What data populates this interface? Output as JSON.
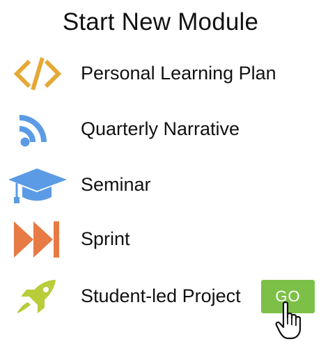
{
  "title": "Start New Module",
  "modules": [
    {
      "label": "Personal Learning Plan",
      "icon": "code-icon",
      "color": "#e5a936"
    },
    {
      "label": "Quarterly Narrative",
      "icon": "rss-icon",
      "color": "#5b9be6"
    },
    {
      "label": "Seminar",
      "icon": "graduation-cap-icon",
      "color": "#5b9be6"
    },
    {
      "label": "Sprint",
      "icon": "fast-forward-icon",
      "color": "#e77a45"
    },
    {
      "label": "Student-led Project",
      "icon": "rocket-icon",
      "color": "#b9cc3a"
    }
  ],
  "go_button": {
    "label": "GO",
    "color": "#7cc048"
  },
  "cursor_icon": "hand-pointer-icon"
}
